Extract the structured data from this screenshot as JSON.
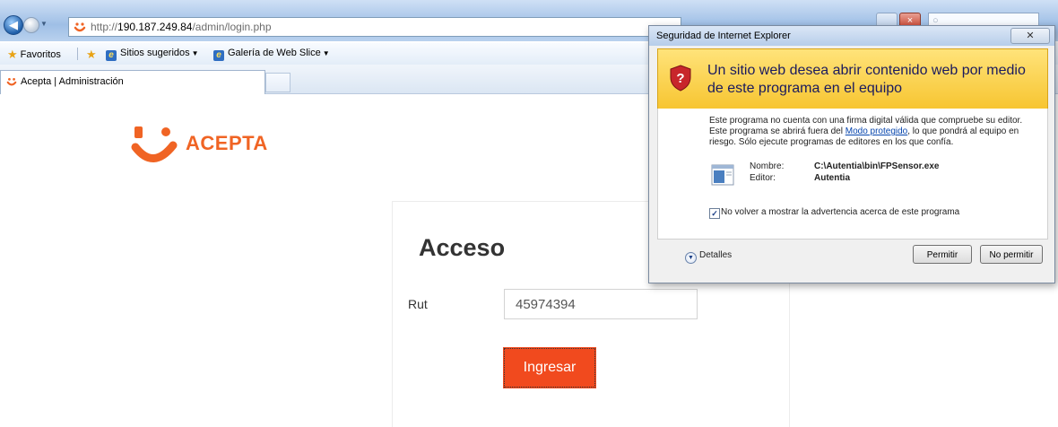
{
  "browser": {
    "url_prefix": "http://",
    "url_host": "190.187.249.84",
    "url_path": "/admin/login.php",
    "search_placeholder": "",
    "favorites_label": "Favoritos",
    "suggested_sites_label": "Sitios sugeridos",
    "web_slice_label": "Galería de Web Slice",
    "tab_title": "Acepta | Administración",
    "close_glyph": "×"
  },
  "page": {
    "logo_text": "ACEPTA",
    "brand_color": "#f06424",
    "login_title": "Acceso",
    "rut_label": "Rut",
    "rut_value": "45974394",
    "submit_label": "Ingresar",
    "button_color": "#f14a1e"
  },
  "dialog": {
    "title": "Seguridad de Internet Explorer",
    "close_glyph": "✕",
    "heading": "Un sitio web desea abrir contenido web por medio de este programa en el equipo",
    "desc_part1": "Este programa no cuenta con una firma digital válida que compruebe su editor. Este programa se abrirá fuera del ",
    "desc_link": "Modo protegido",
    "desc_part2": ", lo que pondrá al equipo en riesgo. Sólo ejecute programas de editores en los que confía.",
    "name_label": "Nombre:",
    "name_value": "C:\\Autentia\\bin\\FPSensor.exe",
    "publisher_label": "Editor:",
    "publisher_value": "Autentia",
    "checkbox_label": "No volver a mostrar la advertencia acerca de este programa",
    "checkbox_checked": true,
    "details_label": "Detalles",
    "allow_label": "Permitir",
    "deny_label": "No permitir",
    "header_color": "#f7c531"
  }
}
